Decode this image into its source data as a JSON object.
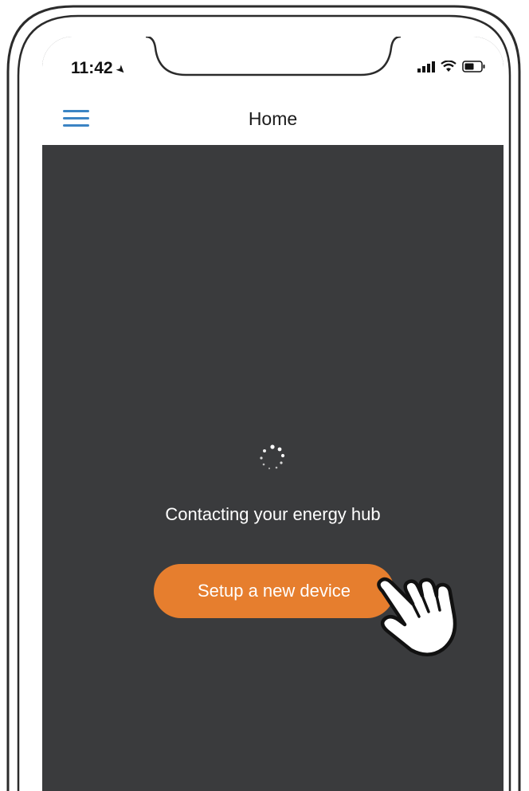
{
  "status_bar": {
    "time": "11:42",
    "icons": [
      "location-arrow-icon",
      "signal-bars-icon",
      "wifi-icon",
      "battery-icon"
    ]
  },
  "nav": {
    "title": "Home",
    "menu_icon": "hamburger-menu-icon"
  },
  "main": {
    "loading_message": "Contacting your energy hub",
    "setup_button_label": "Setup a new device"
  },
  "colors": {
    "background": "#3a3b3d",
    "accent": "#e67e2e",
    "menu_icon": "#3b84c4",
    "bar_background": "#ffffff"
  },
  "decorations": {
    "pointer": "hand-pointer-icon",
    "spinner": "loading-spinner-icon"
  }
}
